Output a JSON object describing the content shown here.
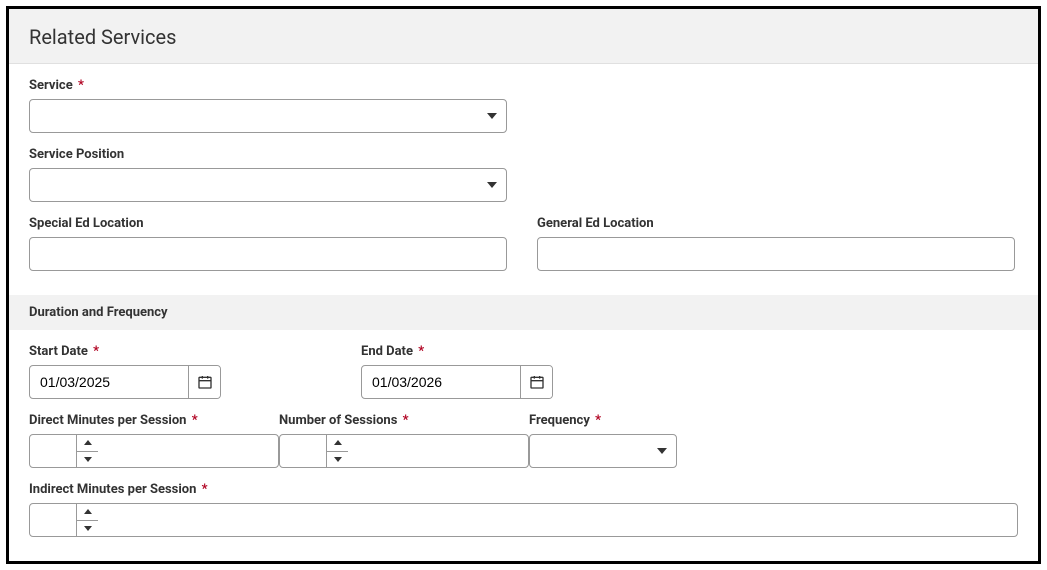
{
  "header": {
    "title": "Related Services"
  },
  "fields": {
    "service": {
      "label": "Service",
      "required": "*",
      "value": ""
    },
    "servicePosition": {
      "label": "Service Position",
      "value": ""
    },
    "specialEdLocation": {
      "label": "Special Ed Location",
      "value": ""
    },
    "generalEdLocation": {
      "label": "General Ed Location",
      "value": ""
    }
  },
  "durationFrequency": {
    "heading": "Duration and Frequency",
    "startDate": {
      "label": "Start Date",
      "required": "*",
      "value": "01/03/2025"
    },
    "endDate": {
      "label": "End Date",
      "required": "*",
      "value": "01/03/2026"
    },
    "directMinutes": {
      "label": "Direct Minutes per Session",
      "required": "*",
      "value": ""
    },
    "numberOfSessions": {
      "label": "Number of Sessions",
      "required": "*",
      "value": ""
    },
    "frequency": {
      "label": "Frequency",
      "required": "*",
      "value": ""
    },
    "indirectMinutes": {
      "label": "Indirect Minutes per Session",
      "required": "*",
      "value": ""
    }
  }
}
